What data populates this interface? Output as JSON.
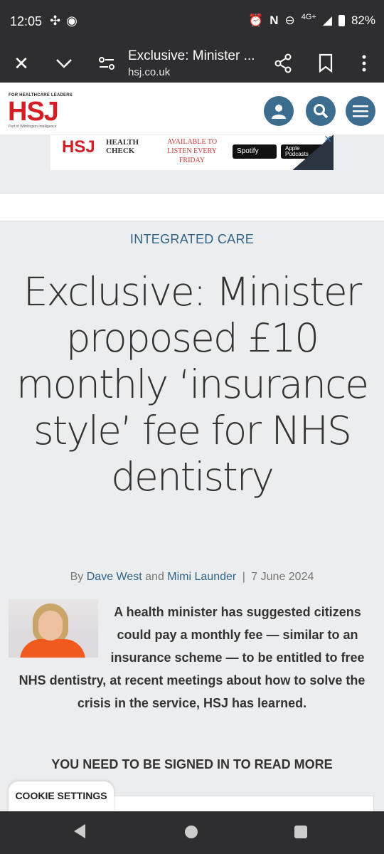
{
  "status_bar": {
    "time": "12:05",
    "network": "4G+",
    "battery": "82%",
    "left_icons": [
      "pinwheel-icon",
      "chrome-icon"
    ],
    "right_icons": [
      "alarm-icon",
      "nfc-icon",
      "dnd-icon",
      "signal-icon",
      "battery-icon"
    ]
  },
  "browser": {
    "title": "Exclusive: Minister ...",
    "url": "hsj.co.uk",
    "icons": [
      "close-icon",
      "chevron-down-icon",
      "page-info-icon",
      "share-icon",
      "bookmark-icon",
      "more-icon"
    ]
  },
  "site": {
    "logo_tagline": "FOR HEALTHCARE LEADERS",
    "logo": "HSJ",
    "logo_sub": "Part of Wilmington Intelligence",
    "accent": "#d21f25",
    "brand_blue": "#3c6d8f"
  },
  "ad": {
    "logo": "HSJ",
    "title_line1": "HEALTH",
    "title_line2": "CHECK",
    "tagline": "AVAILABLE TO LISTEN EVERY FRIDAY",
    "spotify": "Spotify",
    "apple_line1": "Apple",
    "apple_line2": "Podcasts",
    "close": "✕"
  },
  "article": {
    "category": "INTEGRATED CARE",
    "headline": "Exclusive: Minister proposed £10 monthly ‘insurance style’ fee for NHS dentistry",
    "by": "By",
    "author1": "Dave West",
    "and": "and",
    "author2": "Mimi Launder",
    "separator": "|",
    "date": "7 June 2024",
    "lede": "A health minister has suggested citizens could pay a monthly fee — similar to an insurance scheme — to be entitled to free NHS dentistry, at recent meetings about how to solve the crisis in the service, HSJ has learned.",
    "signin_prompt": "YOU NEED TO BE SIGNED IN TO READ MORE"
  },
  "cookie": {
    "label": "COOKIE SETTINGS"
  }
}
